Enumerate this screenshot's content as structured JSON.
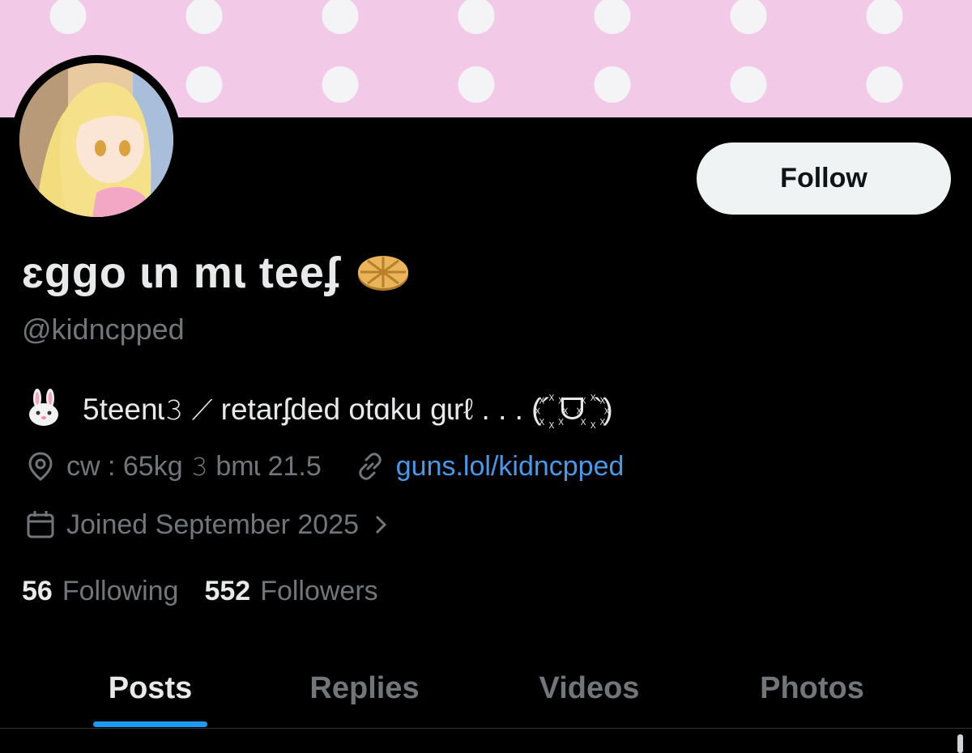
{
  "profile": {
    "display_name": "ɛggo ɩn mɩ teeʄ",
    "name_emoji": "waffle-icon",
    "handle": "@kidncpped",
    "bio_emoji": "rabbit-face-icon",
    "bio": "5teenɩ𝟹 ⟋ retarʄded otɑku gɩrℓ . . . (´꙰ ᗜ ꙰`)",
    "location": "cw : 65kg 𝟹 bmɩ 21.5",
    "website": "guns.lol/kidncpped",
    "joined": "Joined September 2025",
    "follow_label": "Follow"
  },
  "stats": {
    "following_count": "56",
    "following_label": "Following",
    "followers_count": "552",
    "followers_label": "Followers"
  },
  "tabs": [
    {
      "label": "Posts",
      "active": true
    },
    {
      "label": "Replies",
      "active": false
    },
    {
      "label": "Videos",
      "active": false
    },
    {
      "label": "Photos",
      "active": false
    }
  ],
  "colors": {
    "background": "#000000",
    "banner": "#f2c9e6",
    "link": "#4a99e9",
    "muted": "#71767b",
    "accent": "#1d9bf0"
  }
}
